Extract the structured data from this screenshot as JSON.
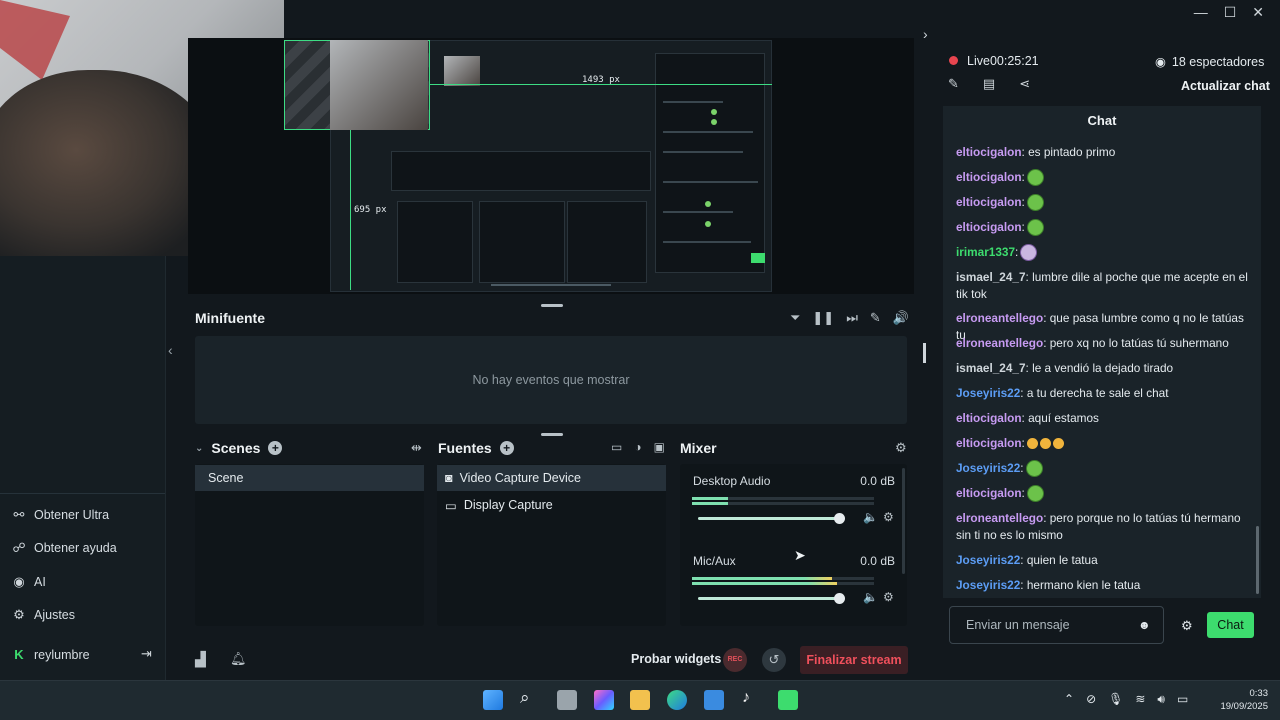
{
  "window": {
    "minimize": "—",
    "maximize": "☐",
    "close": "✕"
  },
  "sidebar": {
    "items": [
      {
        "label": "Obtener Ultra",
        "icon": "ultra-icon"
      },
      {
        "label": "Obtener ayuda",
        "icon": "help-icon"
      },
      {
        "label": "AI",
        "icon": "eye-icon"
      },
      {
        "label": "Ajustes",
        "icon": "gear-icon"
      }
    ],
    "user": {
      "name": "reylumbre",
      "badge": "K"
    }
  },
  "preview": {
    "guide_width": "1493 px",
    "guide_height": "695 px"
  },
  "minifuente": {
    "title": "Minifuente",
    "empty": "No hay eventos que mostrar"
  },
  "scenes": {
    "title": "Scenes",
    "items": [
      "Scene"
    ]
  },
  "fuentes": {
    "title": "Fuentes",
    "items": [
      "Video Capture Device",
      "Display Capture"
    ]
  },
  "mixer": {
    "title": "Mixer",
    "channels": [
      {
        "name": "Desktop Audio",
        "db": "0.0 dB",
        "level": 0.95
      },
      {
        "name": "Mic/Aux",
        "db": "0.0 dB",
        "level": 0.95
      }
    ]
  },
  "bottom": {
    "probar": "Probar widgets",
    "rec": "REC",
    "end_stream": "Finalizar stream"
  },
  "chat": {
    "live_label": "Live",
    "live_time": "00:25:21",
    "viewers": "18 espectadores",
    "refresh": "Actualizar chat",
    "header": "Chat",
    "input_placeholder": "Enviar un mensaje",
    "send": "Chat",
    "colors": {
      "purple": "#c79bf2",
      "blue": "#5c9df5",
      "green": "#3ddc6e"
    },
    "messages": [
      {
        "user": "eltiocigalon",
        "text": ": es pintado primo",
        "color": "purple"
      },
      {
        "user": "eltiocigalon",
        "text": ":",
        "color": "purple",
        "emote": "green"
      },
      {
        "user": "eltiocigalon",
        "text": ":",
        "color": "purple",
        "emote": "green"
      },
      {
        "user": "eltiocigalon",
        "text": ":",
        "color": "purple",
        "emote": "green"
      },
      {
        "user": "irimar1337",
        "text": ":",
        "color": "green",
        "emote": "purple"
      },
      {
        "user": "ismael_24_7",
        "text": ": lumbre dile al poche que me acepte en el tik tok",
        "color": "plain"
      },
      {
        "user": "elroneantellego",
        "text": ": que pasa lumbre como q no le tatúas tu",
        "color": "purple"
      },
      {
        "user": "elroneantellego",
        "text": ": pero xq no lo tatúas tú suhermano",
        "color": "purple"
      },
      {
        "user": "ismael_24_7",
        "text": ": le a vendió la dejado tirado",
        "color": "plain"
      },
      {
        "user": "Joseyiris22",
        "text": ": a tu derecha te sale el chat",
        "color": "blue"
      },
      {
        "user": "eltiocigalon",
        "text": ": aquí estamos",
        "color": "purple"
      },
      {
        "user": "eltiocigalon",
        "text": ":",
        "color": "purple",
        "emote": "small3"
      },
      {
        "user": "Joseyiris22",
        "text": ":",
        "color": "blue",
        "emote": "green"
      },
      {
        "user": "eltiocigalon",
        "text": ":",
        "color": "purple",
        "emote": "green"
      },
      {
        "user": "elroneantellego",
        "text": ": pero porque no lo tatúas tú hermano sin ti no es lo mismo",
        "color": "purple"
      },
      {
        "user": "Joseyiris22",
        "text": ": quien le tatua",
        "color": "blue"
      },
      {
        "user": "Joseyiris22",
        "text": ": hermano kien le tatua",
        "color": "blue"
      }
    ]
  },
  "taskbar": {
    "time": "0:33",
    "date": "19/09/2025"
  }
}
